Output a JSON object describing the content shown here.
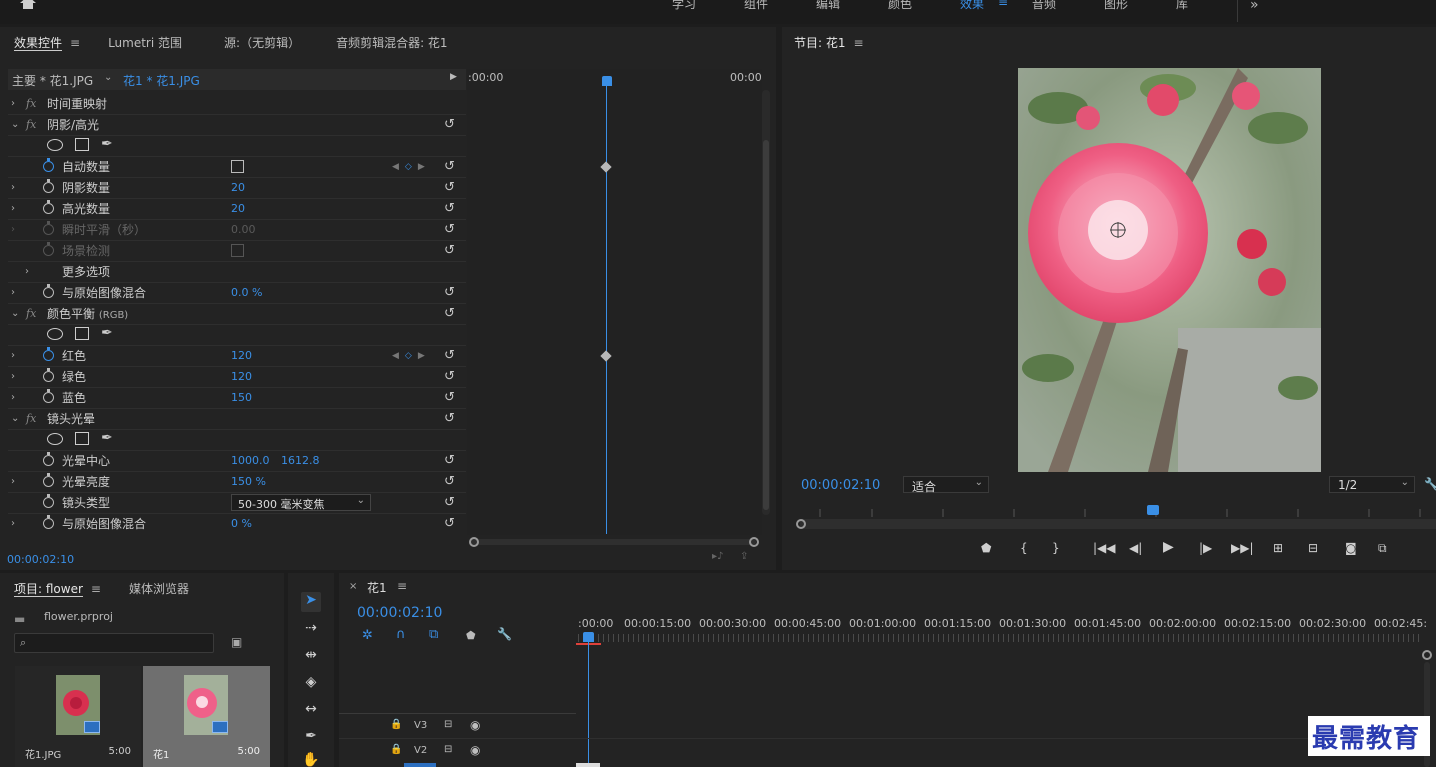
{
  "workspace_tabs": [
    "学习",
    "组件",
    "编辑",
    "颜色",
    "效果",
    "音频",
    "图形",
    "库"
  ],
  "effects_panel": {
    "tabs": [
      "效果控件",
      "Lumetri 范围",
      "源:（无剪辑）",
      "音频剪辑混合器: 花1"
    ],
    "master_label": "主要 * 花1.JPG",
    "clip_label": "花1 * 花1.JPG",
    "time_start": ":00:00",
    "time_end": "00:00",
    "current_time": "00:00:02:10",
    "rows": {
      "time_remap": "时间重映射",
      "shadow_highlight": "阴影/高光",
      "auto_amount": "自动数量",
      "shadow_amount": "阴影数量",
      "shadow_amount_val": "20",
      "highlight_amount": "高光数量",
      "highlight_amount_val": "20",
      "temporal_smooth": "瞬时平滑（秒）",
      "temporal_smooth_val": "0.00",
      "scene_detect": "场景检测",
      "more_options": "更多选项",
      "blend_original": "与原始图像混合",
      "blend_original_val": "0.0 %",
      "color_balance": "颜色平衡",
      "color_balance_suffix": "(RGB)",
      "red": "红色",
      "red_val": "120",
      "green": "绿色",
      "green_val": "120",
      "blue": "蓝色",
      "blue_val": "150",
      "lens_flare": "镜头光晕",
      "flare_center": "光晕中心",
      "flare_center_x": "1000.0",
      "flare_center_y": "1612.8",
      "flare_brightness": "光晕亮度",
      "flare_brightness_val": "150 %",
      "lens_type": "镜头类型",
      "lens_type_val": "50-300 毫米变焦",
      "blend_original2": "与原始图像混合",
      "blend_original2_val": "0 %"
    }
  },
  "program_monitor": {
    "title": "节目: 花1",
    "timecode": "00:00:02:10",
    "fit": "适合",
    "resolution": "1/2"
  },
  "project_panel": {
    "tabs": [
      "项目: flower",
      "媒体浏览器"
    ],
    "project_file": "flower.prproj",
    "items": [
      {
        "name": "花1.JPG",
        "duration": "5:00"
      },
      {
        "name": "花1",
        "duration": "5:00"
      }
    ]
  },
  "timeline": {
    "sequence": "花1",
    "timecode": "00:00:02:10",
    "ruler": [
      ":00:00",
      "00:00:15:00",
      "00:00:30:00",
      "00:00:45:00",
      "00:01:00:00",
      "00:01:15:00",
      "00:01:30:00",
      "00:01:45:00",
      "00:02:00:00",
      "00:02:15:00",
      "00:02:30:00",
      "00:02:45:"
    ],
    "tracks": [
      "V3",
      "V2"
    ]
  },
  "watermark": "最需教育"
}
